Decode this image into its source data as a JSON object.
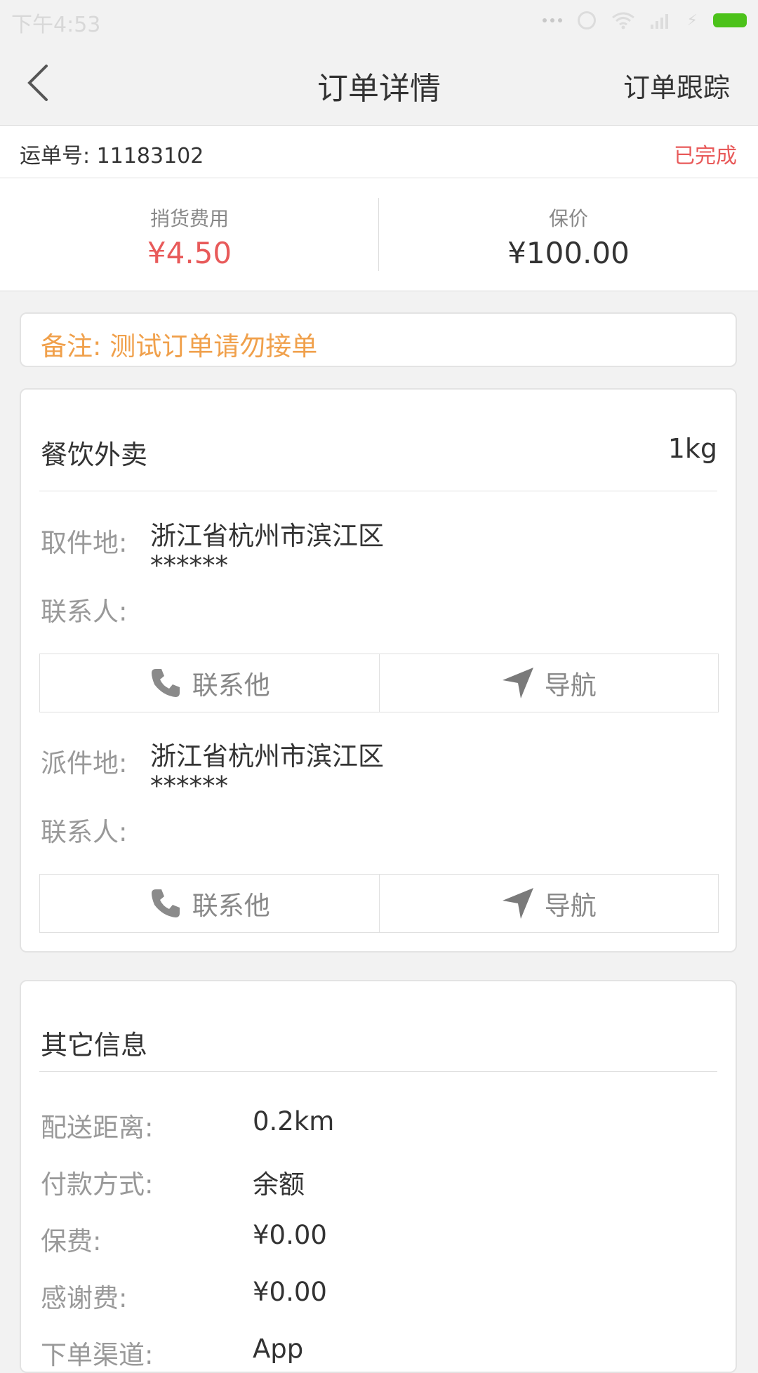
{
  "status_bar": {
    "time": "下午4:53"
  },
  "nav": {
    "title": "订单详情",
    "right_label": "订单跟踪"
  },
  "order": {
    "number_label": "运单号:",
    "number": "11183102",
    "status": "已完成",
    "status_color": "#e85a5a"
  },
  "fees": {
    "delivery_title": "捎货费用",
    "delivery_value": "¥4.50",
    "insured_title": "保价",
    "insured_value": "¥100.00"
  },
  "note": {
    "text": "备注: 测试订单请勿接单"
  },
  "cargo": {
    "type": "餐饮外卖",
    "weight": "1kg"
  },
  "pickup": {
    "label": "取件地:",
    "address": "浙江省杭州市滨江区",
    "detail": "******",
    "contact_label": "联系人:",
    "call_label": "联系他",
    "nav_label": "导航"
  },
  "dropoff": {
    "label": "派件地:",
    "address": "浙江省杭州市滨江区",
    "detail": "******",
    "contact_label": "联系人:",
    "call_label": "联系他",
    "nav_label": "导航"
  },
  "other": {
    "title": "其它信息",
    "rows": [
      {
        "label": "配送距离:",
        "value": "0.2km"
      },
      {
        "label": "付款方式:",
        "value": "余额"
      },
      {
        "label": "保费:",
        "value": "¥0.00"
      },
      {
        "label": "感谢费:",
        "value": "¥0.00"
      },
      {
        "label": "下单渠道:",
        "value": "App"
      }
    ]
  },
  "colors": {
    "accent_price": "#e85a5a",
    "note": "#f0a04b",
    "battery": "#4cc21a"
  }
}
